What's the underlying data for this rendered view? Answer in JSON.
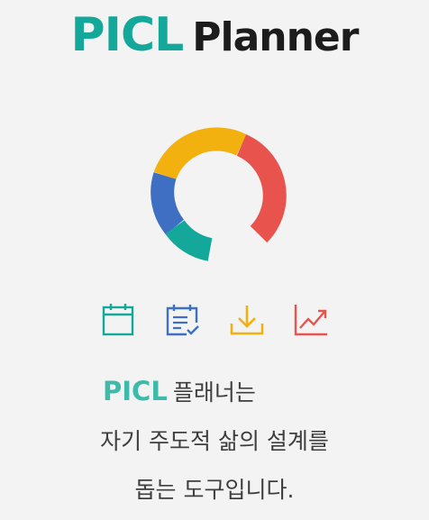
{
  "header": {
    "brand": "PICL",
    "product": "Planner"
  },
  "logo": {
    "segments": [
      {
        "name": "yellow",
        "color": "#f2b10f"
      },
      {
        "name": "red",
        "color": "#e8544d"
      },
      {
        "name": "teal",
        "color": "#14a89a"
      },
      {
        "name": "blue",
        "color": "#3f6fc2"
      }
    ]
  },
  "icons": [
    {
      "name": "calendar-icon",
      "color": "#14a89a"
    },
    {
      "name": "checklist-icon",
      "color": "#3f6fc2"
    },
    {
      "name": "download-icon",
      "color": "#f2b10f"
    },
    {
      "name": "chart-trend-icon",
      "color": "#e8544d"
    }
  ],
  "description": {
    "brand": "PICL",
    "line1": "플래너는",
    "line2": "자기 주도적 삶의 설계를",
    "line3": "돕는 도구입니다."
  }
}
